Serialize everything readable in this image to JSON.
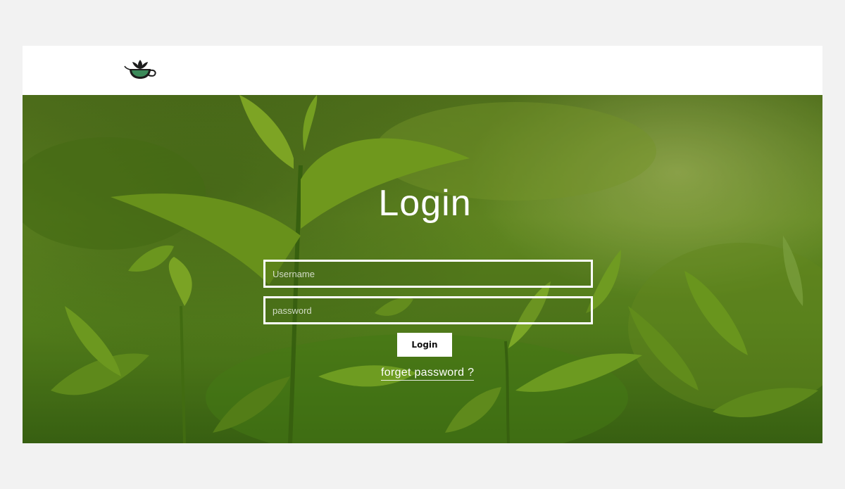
{
  "header": {
    "logo_icon": "teacup-leaf-logo-icon"
  },
  "login": {
    "title": "Login",
    "username_placeholder": "Username",
    "password_placeholder": "password",
    "submit_label": "Login",
    "forgot_label": "forget password ?"
  },
  "colors": {
    "page_background": "#f2f2f2",
    "header_background": "#ffffff",
    "hero_green": "#6f9a26",
    "field_border": "#ffffff",
    "button_background": "#ffffff",
    "button_text": "#111111"
  }
}
